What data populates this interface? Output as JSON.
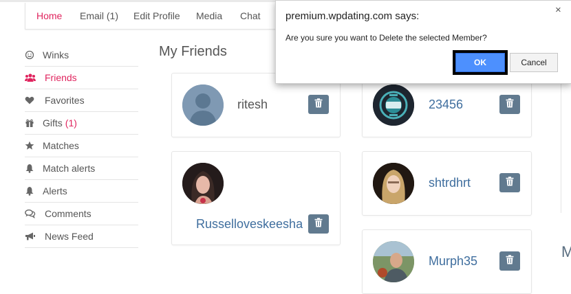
{
  "nav": {
    "items": [
      {
        "label": "Home"
      },
      {
        "label": "Email (1)"
      },
      {
        "label": "Edit Profile"
      },
      {
        "label": "Media"
      },
      {
        "label": "Chat"
      }
    ]
  },
  "sidebar": {
    "items": [
      {
        "label": "Winks",
        "icon": "smile-icon"
      },
      {
        "label": "Friends",
        "icon": "users-icon"
      },
      {
        "label": "Favorites",
        "icon": "heart-icon"
      },
      {
        "label": "Gifts",
        "count": "(1)",
        "icon": "gift-icon"
      },
      {
        "label": "Matches",
        "icon": "star-icon"
      },
      {
        "label": "Match alerts",
        "icon": "bell-icon"
      },
      {
        "label": "Alerts",
        "icon": "bell-icon"
      },
      {
        "label": "Comments",
        "icon": "comments-icon"
      },
      {
        "label": "News Feed",
        "icon": "bullhorn-icon"
      }
    ]
  },
  "main": {
    "title": "My Friends",
    "friends": [
      {
        "name": "ritesh"
      },
      {
        "name": "23456"
      },
      {
        "name": "Russelloveskeesha"
      },
      {
        "name": "shtrdhrt"
      },
      {
        "name": "Murph35"
      }
    ],
    "right_letter": "M"
  },
  "dialog": {
    "title": "premium.wpdating.com says:",
    "message": "Are you sure you want to Delete the selected Member?",
    "ok_label": "OK",
    "cancel_label": "Cancel",
    "close_glyph": "×"
  },
  "colors": {
    "accent": "#e0245e",
    "link": "#3f6e9e",
    "delete_button": "#617a8f",
    "ok_button": "#4d90fe"
  }
}
